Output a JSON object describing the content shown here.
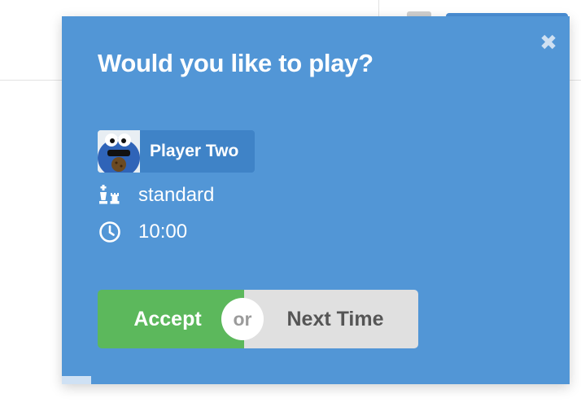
{
  "modal": {
    "close_icon": "close-icon",
    "title": "Would you like to play?",
    "player": {
      "name": "Player Two",
      "avatar": "avatar-image"
    },
    "variant": {
      "icon": "chess-pieces-icon",
      "label": "standard"
    },
    "time_control": {
      "icon": "clock-icon",
      "label": "10:00"
    },
    "actions": {
      "accept_label": "Accept",
      "separator_label": "or",
      "decline_label": "Next Time"
    }
  },
  "colors": {
    "modal_bg": "#5296d6",
    "chip_bg": "#3f83c7",
    "accept_bg": "#5cb85c",
    "decline_bg": "#e0e0e0",
    "text": "#ffffff"
  }
}
